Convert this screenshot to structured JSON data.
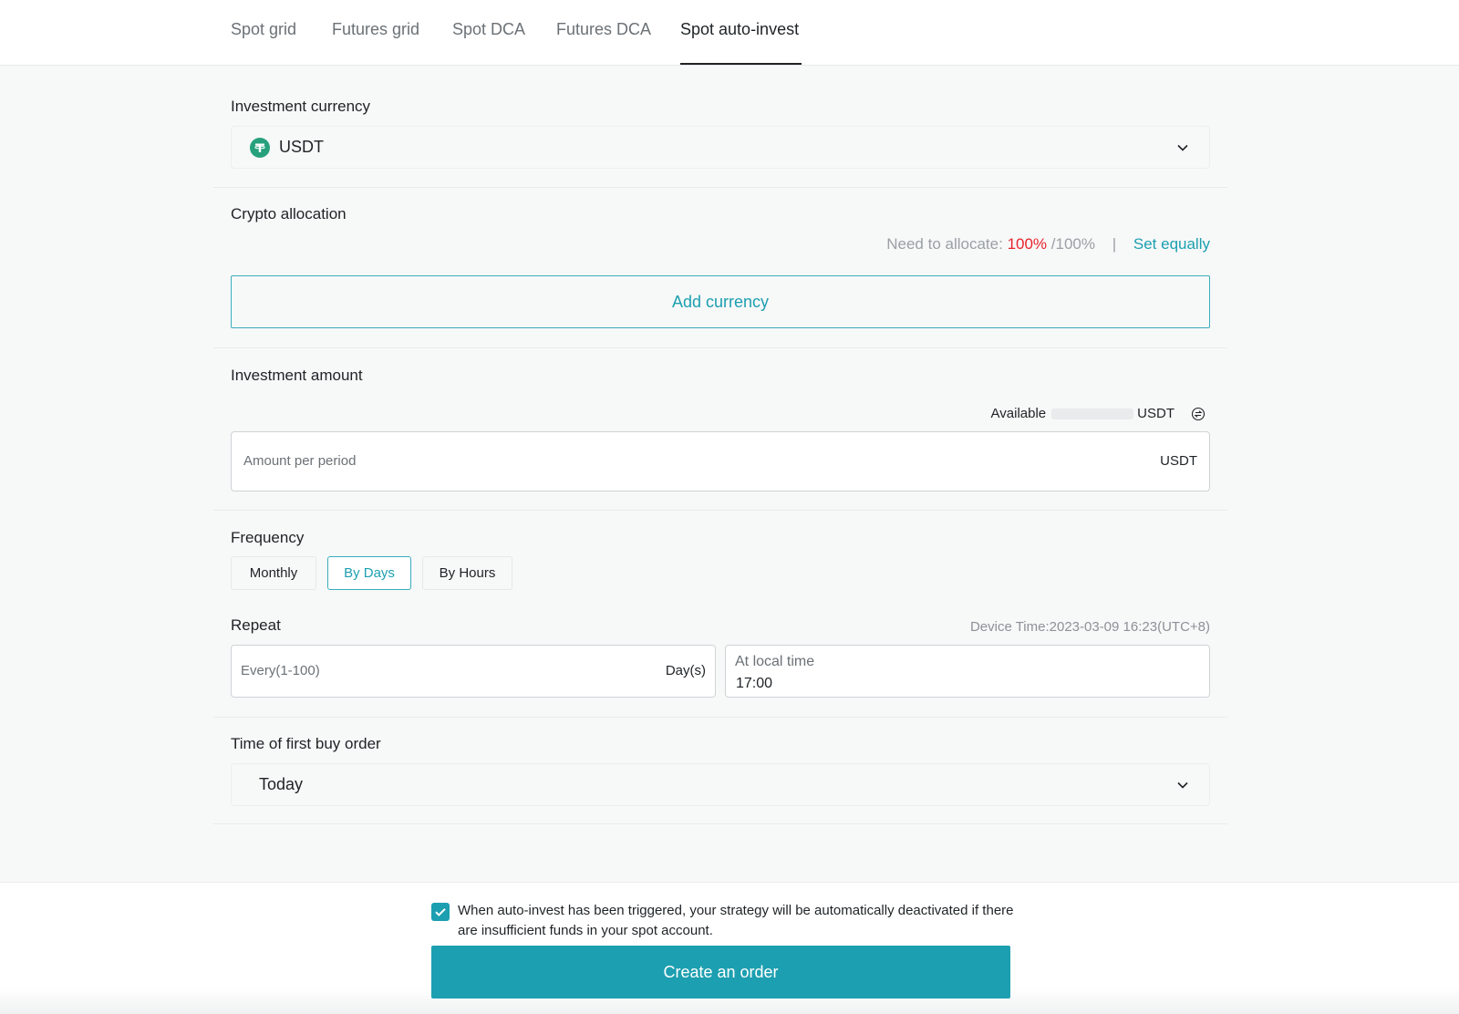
{
  "tabs": [
    {
      "label": "Spot grid"
    },
    {
      "label": "Futures grid"
    },
    {
      "label": "Spot DCA"
    },
    {
      "label": "Futures DCA"
    },
    {
      "label": "Spot auto-invest",
      "active": true
    }
  ],
  "investment_currency": {
    "label": "Investment currency",
    "selected": "USDT",
    "icon": "tether-icon"
  },
  "crypto_allocation": {
    "label": "Crypto allocation",
    "need_label": "Need to allocate:",
    "allocated": "100%",
    "total": "/100%",
    "separator": "|",
    "set_equally": "Set equally",
    "add_currency": "Add currency"
  },
  "investment_amount": {
    "label": "Investment amount",
    "available_label": "Available",
    "available_unit": "USDT",
    "placeholder": "Amount per period",
    "unit": "USDT"
  },
  "frequency": {
    "label": "Frequency",
    "options": [
      "Monthly",
      "By Days",
      "By Hours"
    ],
    "selected": "By Days"
  },
  "repeat": {
    "label": "Repeat",
    "device_time": "Device Time:2023-03-09 16:23(UTC+8)",
    "every_placeholder": "Every(1-100)",
    "every_unit": "Day(s)",
    "local_time_label": "At local time",
    "local_time_value": "17:00"
  },
  "first_buy": {
    "label": "Time of first buy order",
    "selected": "Today"
  },
  "footer": {
    "checked": true,
    "notice": "When auto-invest has been triggered, your strategy will be automatically deactivated if there are insufficient funds in your spot account.",
    "create_button": "Create an order"
  },
  "colors": {
    "accent": "#1c9fb0",
    "warning": "#e8242e",
    "tether": "#26a17b"
  }
}
